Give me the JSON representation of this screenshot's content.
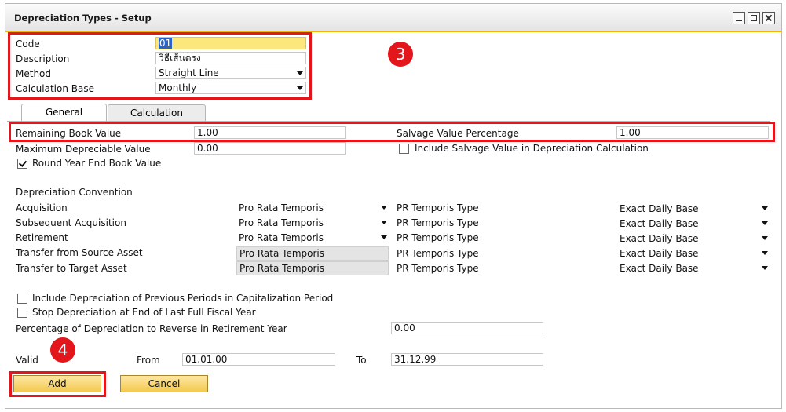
{
  "window": {
    "title": "Depreciation Types - Setup"
  },
  "header": {
    "code_label": "Code",
    "code_value": "01",
    "description_label": "Description",
    "description_value": "วิธีเส้นตรง",
    "method_label": "Method",
    "method_value": "Straight Line",
    "calc_base_label": "Calculation Base",
    "calc_base_value": "Monthly"
  },
  "tabs": [
    {
      "label": "General",
      "active": true
    },
    {
      "label": "Calculation",
      "active": false
    }
  ],
  "general": {
    "remaining_book_value_label": "Remaining Book Value",
    "remaining_book_value": "1.00",
    "salvage_pct_label": "Salvage Value Percentage",
    "salvage_pct_value": "1.00",
    "max_depreciable_label": "Maximum Depreciable Value",
    "max_depreciable_value": "0.00",
    "include_salvage_label": "Include Salvage Value in Depreciation Calculation",
    "include_salvage_checked": false,
    "round_year_end_label": "Round Year End Book Value",
    "round_year_end_checked": true,
    "convention_heading": "Depreciation Convention",
    "pr_type_label": "PR Temporis Type",
    "conventions": [
      {
        "label": "Acquisition",
        "value": "Pro Rata Temporis",
        "editable": true,
        "pr_type": "Exact Daily Base"
      },
      {
        "label": "Subsequent Acquisition",
        "value": "Pro Rata Temporis",
        "editable": true,
        "pr_type": "Exact Daily Base"
      },
      {
        "label": "Retirement",
        "value": "Pro Rata Temporis",
        "editable": true,
        "pr_type": "Exact Daily Base"
      },
      {
        "label": "Transfer from Source Asset",
        "value": "Pro Rata Temporis",
        "editable": false,
        "pr_type": "Exact Daily Base"
      },
      {
        "label": "Transfer to Target Asset",
        "value": "Pro Rata Temporis",
        "editable": false,
        "pr_type": "Exact Daily Base"
      }
    ],
    "include_prev_periods_label": "Include Depreciation of Previous Periods in Capitalization Period",
    "include_prev_periods_checked": false,
    "stop_depreciation_label": "Stop Depreciation at End of Last Full Fiscal Year",
    "stop_depreciation_checked": false,
    "reverse_pct_label": "Percentage of Depreciation to Reverse in Retirement Year",
    "reverse_pct_value": "0.00",
    "valid_label": "Valid",
    "from_label": "From",
    "from_value": "01.01.00",
    "to_label": "To",
    "to_value": "31.12.99"
  },
  "buttons": {
    "add": "Add",
    "cancel": "Cancel"
  },
  "annotations": {
    "badge_header": "3",
    "badge_add": "4",
    "highlight_color": "#e3161b"
  }
}
